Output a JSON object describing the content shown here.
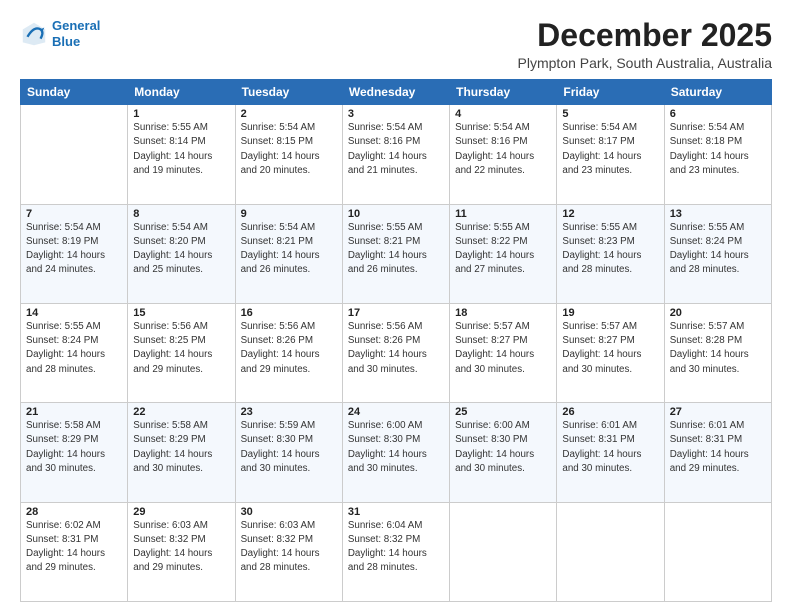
{
  "header": {
    "logo_line1": "General",
    "logo_line2": "Blue",
    "title": "December 2025",
    "subtitle": "Plympton Park, South Australia, Australia"
  },
  "columns": [
    "Sunday",
    "Monday",
    "Tuesday",
    "Wednesday",
    "Thursday",
    "Friday",
    "Saturday"
  ],
  "weeks": [
    [
      {
        "day": "",
        "sunrise": "",
        "sunset": "",
        "daylight": ""
      },
      {
        "day": "1",
        "sunrise": "Sunrise: 5:55 AM",
        "sunset": "Sunset: 8:14 PM",
        "daylight": "Daylight: 14 hours and 19 minutes."
      },
      {
        "day": "2",
        "sunrise": "Sunrise: 5:54 AM",
        "sunset": "Sunset: 8:15 PM",
        "daylight": "Daylight: 14 hours and 20 minutes."
      },
      {
        "day": "3",
        "sunrise": "Sunrise: 5:54 AM",
        "sunset": "Sunset: 8:16 PM",
        "daylight": "Daylight: 14 hours and 21 minutes."
      },
      {
        "day": "4",
        "sunrise": "Sunrise: 5:54 AM",
        "sunset": "Sunset: 8:16 PM",
        "daylight": "Daylight: 14 hours and 22 minutes."
      },
      {
        "day": "5",
        "sunrise": "Sunrise: 5:54 AM",
        "sunset": "Sunset: 8:17 PM",
        "daylight": "Daylight: 14 hours and 23 minutes."
      },
      {
        "day": "6",
        "sunrise": "Sunrise: 5:54 AM",
        "sunset": "Sunset: 8:18 PM",
        "daylight": "Daylight: 14 hours and 23 minutes."
      }
    ],
    [
      {
        "day": "7",
        "sunrise": "Sunrise: 5:54 AM",
        "sunset": "Sunset: 8:19 PM",
        "daylight": "Daylight: 14 hours and 24 minutes."
      },
      {
        "day": "8",
        "sunrise": "Sunrise: 5:54 AM",
        "sunset": "Sunset: 8:20 PM",
        "daylight": "Daylight: 14 hours and 25 minutes."
      },
      {
        "day": "9",
        "sunrise": "Sunrise: 5:54 AM",
        "sunset": "Sunset: 8:21 PM",
        "daylight": "Daylight: 14 hours and 26 minutes."
      },
      {
        "day": "10",
        "sunrise": "Sunrise: 5:55 AM",
        "sunset": "Sunset: 8:21 PM",
        "daylight": "Daylight: 14 hours and 26 minutes."
      },
      {
        "day": "11",
        "sunrise": "Sunrise: 5:55 AM",
        "sunset": "Sunset: 8:22 PM",
        "daylight": "Daylight: 14 hours and 27 minutes."
      },
      {
        "day": "12",
        "sunrise": "Sunrise: 5:55 AM",
        "sunset": "Sunset: 8:23 PM",
        "daylight": "Daylight: 14 hours and 28 minutes."
      },
      {
        "day": "13",
        "sunrise": "Sunrise: 5:55 AM",
        "sunset": "Sunset: 8:24 PM",
        "daylight": "Daylight: 14 hours and 28 minutes."
      }
    ],
    [
      {
        "day": "14",
        "sunrise": "Sunrise: 5:55 AM",
        "sunset": "Sunset: 8:24 PM",
        "daylight": "Daylight: 14 hours and 28 minutes."
      },
      {
        "day": "15",
        "sunrise": "Sunrise: 5:56 AM",
        "sunset": "Sunset: 8:25 PM",
        "daylight": "Daylight: 14 hours and 29 minutes."
      },
      {
        "day": "16",
        "sunrise": "Sunrise: 5:56 AM",
        "sunset": "Sunset: 8:26 PM",
        "daylight": "Daylight: 14 hours and 29 minutes."
      },
      {
        "day": "17",
        "sunrise": "Sunrise: 5:56 AM",
        "sunset": "Sunset: 8:26 PM",
        "daylight": "Daylight: 14 hours and 30 minutes."
      },
      {
        "day": "18",
        "sunrise": "Sunrise: 5:57 AM",
        "sunset": "Sunset: 8:27 PM",
        "daylight": "Daylight: 14 hours and 30 minutes."
      },
      {
        "day": "19",
        "sunrise": "Sunrise: 5:57 AM",
        "sunset": "Sunset: 8:27 PM",
        "daylight": "Daylight: 14 hours and 30 minutes."
      },
      {
        "day": "20",
        "sunrise": "Sunrise: 5:57 AM",
        "sunset": "Sunset: 8:28 PM",
        "daylight": "Daylight: 14 hours and 30 minutes."
      }
    ],
    [
      {
        "day": "21",
        "sunrise": "Sunrise: 5:58 AM",
        "sunset": "Sunset: 8:29 PM",
        "daylight": "Daylight: 14 hours and 30 minutes."
      },
      {
        "day": "22",
        "sunrise": "Sunrise: 5:58 AM",
        "sunset": "Sunset: 8:29 PM",
        "daylight": "Daylight: 14 hours and 30 minutes."
      },
      {
        "day": "23",
        "sunrise": "Sunrise: 5:59 AM",
        "sunset": "Sunset: 8:30 PM",
        "daylight": "Daylight: 14 hours and 30 minutes."
      },
      {
        "day": "24",
        "sunrise": "Sunrise: 6:00 AM",
        "sunset": "Sunset: 8:30 PM",
        "daylight": "Daylight: 14 hours and 30 minutes."
      },
      {
        "day": "25",
        "sunrise": "Sunrise: 6:00 AM",
        "sunset": "Sunset: 8:30 PM",
        "daylight": "Daylight: 14 hours and 30 minutes."
      },
      {
        "day": "26",
        "sunrise": "Sunrise: 6:01 AM",
        "sunset": "Sunset: 8:31 PM",
        "daylight": "Daylight: 14 hours and 30 minutes."
      },
      {
        "day": "27",
        "sunrise": "Sunrise: 6:01 AM",
        "sunset": "Sunset: 8:31 PM",
        "daylight": "Daylight: 14 hours and 29 minutes."
      }
    ],
    [
      {
        "day": "28",
        "sunrise": "Sunrise: 6:02 AM",
        "sunset": "Sunset: 8:31 PM",
        "daylight": "Daylight: 14 hours and 29 minutes."
      },
      {
        "day": "29",
        "sunrise": "Sunrise: 6:03 AM",
        "sunset": "Sunset: 8:32 PM",
        "daylight": "Daylight: 14 hours and 29 minutes."
      },
      {
        "day": "30",
        "sunrise": "Sunrise: 6:03 AM",
        "sunset": "Sunset: 8:32 PM",
        "daylight": "Daylight: 14 hours and 28 minutes."
      },
      {
        "day": "31",
        "sunrise": "Sunrise: 6:04 AM",
        "sunset": "Sunset: 8:32 PM",
        "daylight": "Daylight: 14 hours and 28 minutes."
      },
      {
        "day": "",
        "sunrise": "",
        "sunset": "",
        "daylight": ""
      },
      {
        "day": "",
        "sunrise": "",
        "sunset": "",
        "daylight": ""
      },
      {
        "day": "",
        "sunrise": "",
        "sunset": "",
        "daylight": ""
      }
    ]
  ]
}
